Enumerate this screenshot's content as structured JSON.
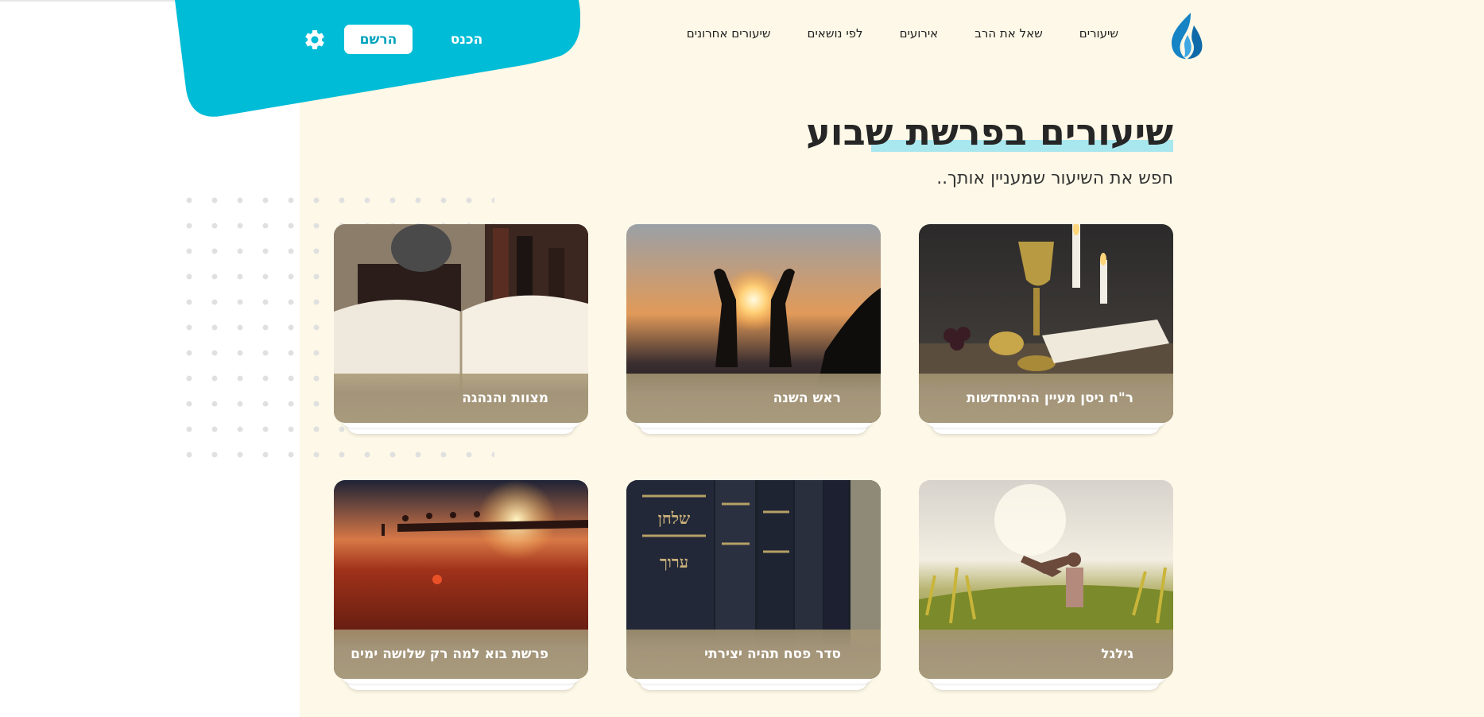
{
  "header": {
    "login_label": "הכנס",
    "register_label": "הרשם",
    "accent_color": "#00bcd6"
  },
  "nav": {
    "items": [
      "שיעורים אחרונים",
      "לפי נושאים",
      "אירועים",
      "שאל את הרב",
      "שיעורים"
    ]
  },
  "main": {
    "title": "שיעורים בפרשת שבוע",
    "subtitle": "חפש את השיעור שמעניין אותך.."
  },
  "cards": [
    {
      "label": "ר\"ח ניסן מעיין ההיתחדשות",
      "image": "kiddush-cup-and-candles"
    },
    {
      "label": "ראש השנה",
      "image": "hands-at-sunset"
    },
    {
      "label": "מצוות והנהגה",
      "image": "open-talmud-book"
    },
    {
      "label": "גילגל",
      "image": "man-in-field"
    },
    {
      "label": "סדר פסח תהיה יצירתי",
      "image": "shulchan-aruch-books"
    },
    {
      "label": "פרשת בוא למה רק שלושה ימים",
      "image": "camels-in-desert"
    }
  ],
  "icons": {
    "logo": "flame-logo-icon",
    "settings": "gear-icon"
  }
}
